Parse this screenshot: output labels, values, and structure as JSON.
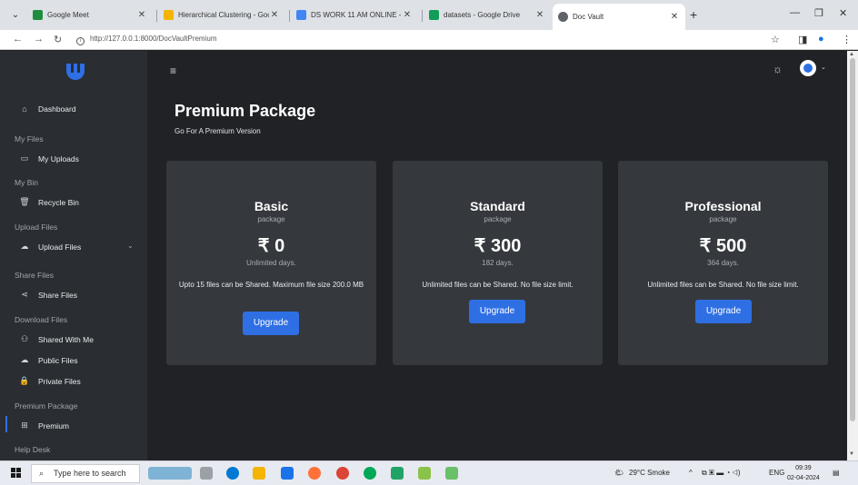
{
  "browser": {
    "tabs": [
      {
        "title": "Google Meet",
        "color": "#1e8e3e"
      },
      {
        "title": "Hierarchical Clustering - Google",
        "color": "#f4b400"
      },
      {
        "title": "DS WORK 11 AM ONLINE - Goo",
        "color": "#4285f4"
      },
      {
        "title": "datasets - Google Drive",
        "color": "#0f9d58"
      },
      {
        "title": "Doc Vault",
        "color": "#5f6368"
      }
    ],
    "url": "http://127.0.0.1:8000/DocVaultPremium"
  },
  "sidebar": {
    "dashboard": "Dashboard",
    "my_files_head": "My Files",
    "my_uploads": "My Uploads",
    "my_bin_head": "My Bin",
    "recycle_bin": "Recycle Bin",
    "upload_files_head": "Upload Files",
    "upload_files": "Upload Files",
    "share_files_head": "Share Files",
    "share_files": "Share Files",
    "download_files_head": "Download Files",
    "shared_with_me": "Shared With Me",
    "public_files": "Public Files",
    "private_files": "Private Files",
    "premium_head": "Premium Package",
    "premium": "Premium",
    "help_head": "Help Desk"
  },
  "main": {
    "title": "Premium Package",
    "subtitle": "Go For A Premium Version"
  },
  "cards": [
    {
      "name": "Basic",
      "pkg": "package",
      "price": "₹ 0",
      "days": "Unlimited days.",
      "desc": "Upto 15 files can be Shared. Maximum file size 200.0 MB",
      "button": "Upgrade"
    },
    {
      "name": "Standard",
      "pkg": "package",
      "price": "₹ 300",
      "days": "182 days.",
      "desc": "Unlimited files can be Shared. No file size limit.",
      "button": "Upgrade"
    },
    {
      "name": "Professional",
      "pkg": "package",
      "price": "₹ 500",
      "days": "364 days.",
      "desc": "Unlimited files can be Shared. No file size limit.",
      "button": "Upgrade"
    }
  ],
  "taskbar": {
    "search_placeholder": "Type here to search",
    "weather": "29°C  Smoke",
    "lang": "ENG",
    "time": "09:39",
    "date": "02-04-2024"
  },
  "colors": {
    "accent": "#2f6fe4",
    "sidebar": "#2a2d31",
    "card": "#35383d"
  }
}
